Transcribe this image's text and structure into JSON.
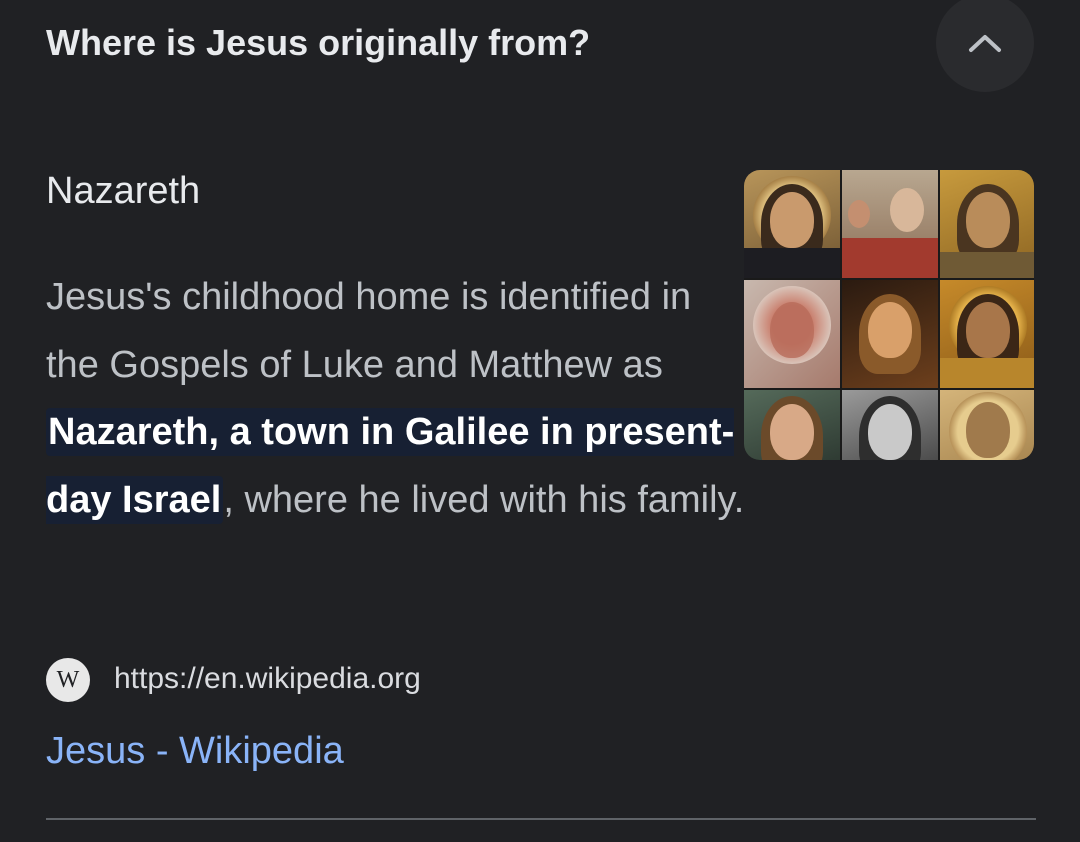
{
  "question": "Where is Jesus originally from?",
  "collapse_icon": "chevron-up-icon",
  "answer": {
    "title": "Nazareth",
    "snippet_before": "Jesus's childhood home is identified in the Gospels of Luke and Matthew as ",
    "snippet_highlight": "Nazareth, a town in Galilee in present-day Israel",
    "snippet_after": ", where he lived with his family."
  },
  "image_icon": "jesus-portraits-collage",
  "source": {
    "icon_letter": "W",
    "url": "https://en.wikipedia.org",
    "link_title": "Jesus - Wikipedia"
  },
  "colors": {
    "background": "#202124",
    "link": "#8ab4f8",
    "highlight_bg": "#172033",
    "text": "#e8eaed",
    "muted_text": "#bdc1c6"
  }
}
